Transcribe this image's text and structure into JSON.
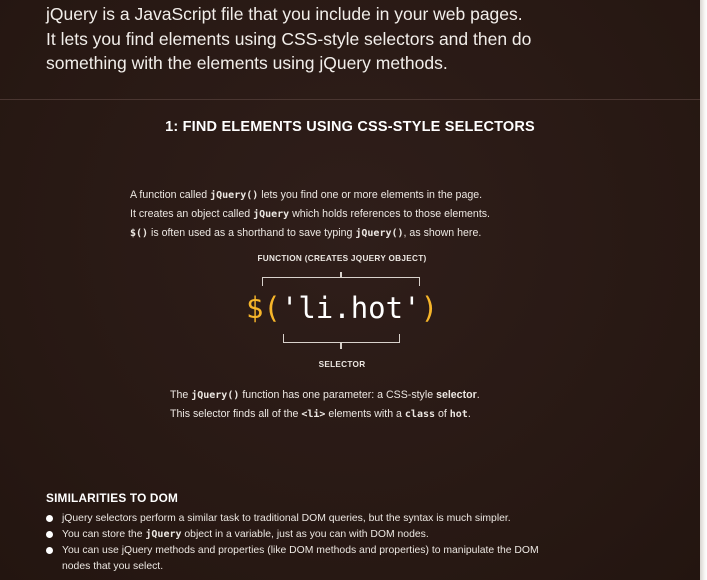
{
  "intro": {
    "line1": "jQuery is a JavaScript file that you include in your web pages.",
    "line2": "It lets you find elements using CSS-style selectors and then do",
    "line3": "something with the elements using jQuery methods."
  },
  "section": {
    "heading": "1: FIND ELEMENTS USING CSS-STYLE SELECTORS"
  },
  "function_desc": {
    "l1_a": "A function called ",
    "l1_code": "jQuery()",
    "l1_b": " lets you find one or more elements in the page.",
    "l2_a": "It creates an object called ",
    "l2_code": "jQuery",
    "l2_b": " which holds references to those elements.",
    "l3_code": "$()",
    "l3_a": " is often used as a shorthand to save typing ",
    "l3_code2": "jQuery()",
    "l3_b": ", as shown here."
  },
  "diagram": {
    "function_label": "FUNCTION (CREATES JQUERY OBJECT)",
    "code_open": "$(",
    "code_selector": "'li.hot'",
    "code_close": ")",
    "selector_label": "SELECTOR",
    "accent_color": "#f6b52a"
  },
  "param_desc": {
    "l1_a": "The ",
    "l1_code": "jQuery()",
    "l1_b": " function has one parameter: a CSS-style ",
    "l1_strong": "selector",
    "l1_c": ".",
    "l2_a": "This selector finds all of the ",
    "l2_code": "<li>",
    "l2_b": " elements with a ",
    "l2_code2": "class",
    "l2_c": " of ",
    "l2_code3": "hot",
    "l2_d": "."
  },
  "similarities": {
    "heading": "SIMILARITIES TO DOM",
    "item1": "jQuery selectors perform a similar task to traditional DOM queries, but the syntax is much simpler.",
    "item2_a": "You can store the ",
    "item2_code": "jQuery",
    "item2_b": " object in a variable, just as you can with DOM nodes.",
    "item3_l1": "You can use jQuery methods and properties (like DOM methods and properties) to manipulate the DOM",
    "item3_l2": "nodes that you select."
  },
  "colors": {
    "background": "#2a1a16",
    "text": "#ece7e2"
  }
}
